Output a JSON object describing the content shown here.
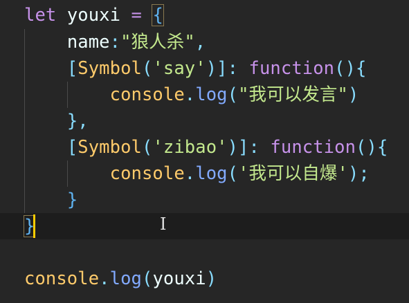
{
  "editor": {
    "lines": [
      [
        {
          "t": "let",
          "c": "kw"
        },
        {
          "t": " "
        },
        {
          "t": "youxi",
          "c": "id"
        },
        {
          "t": " "
        },
        {
          "t": "=",
          "c": "op"
        },
        {
          "t": " "
        },
        {
          "t": "{",
          "c": "br match"
        }
      ],
      [
        {
          "t": "    "
        },
        {
          "t": "name",
          "c": "prop"
        },
        {
          "t": ":",
          "c": "pun"
        },
        {
          "t": "\"狼人杀\"",
          "c": "str"
        },
        {
          "t": ",",
          "c": "pun"
        }
      ],
      [
        {
          "t": "    "
        },
        {
          "t": "[",
          "c": "pun"
        },
        {
          "t": "Symbol",
          "c": "cls"
        },
        {
          "t": "(",
          "c": "pun"
        },
        {
          "t": "'say'",
          "c": "str"
        },
        {
          "t": ")]",
          "c": "pun"
        },
        {
          "t": ":",
          "c": "pun"
        },
        {
          "t": " "
        },
        {
          "t": "function",
          "c": "kw"
        },
        {
          "t": "(){",
          "c": "pun"
        }
      ],
      [
        {
          "t": "        "
        },
        {
          "t": "console",
          "c": "cls"
        },
        {
          "t": ".",
          "c": "pun"
        },
        {
          "t": "log",
          "c": "fn"
        },
        {
          "t": "(",
          "c": "pun"
        },
        {
          "t": "\"我可以发言\"",
          "c": "str"
        },
        {
          "t": ")",
          "c": "pun"
        }
      ],
      [
        {
          "t": "    "
        },
        {
          "t": "},",
          "c": "pun"
        }
      ],
      [
        {
          "t": "    "
        },
        {
          "t": "[",
          "c": "pun"
        },
        {
          "t": "Symbol",
          "c": "cls"
        },
        {
          "t": "(",
          "c": "pun"
        },
        {
          "t": "'zibao'",
          "c": "str"
        },
        {
          "t": ")]",
          "c": "pun"
        },
        {
          "t": ":",
          "c": "pun"
        },
        {
          "t": " "
        },
        {
          "t": "function",
          "c": "kw"
        },
        {
          "t": "(){",
          "c": "pun"
        }
      ],
      [
        {
          "t": "        "
        },
        {
          "t": "console",
          "c": "cls"
        },
        {
          "t": ".",
          "c": "pun"
        },
        {
          "t": "log",
          "c": "fn"
        },
        {
          "t": "(",
          "c": "pun"
        },
        {
          "t": "'我可以自爆'",
          "c": "str"
        },
        {
          "t": ");",
          "c": "pun"
        }
      ],
      [
        {
          "t": "    "
        },
        {
          "t": "}",
          "c": "br"
        }
      ],
      [
        {
          "t": "}",
          "c": "br match"
        }
      ],
      [],
      [
        {
          "t": "console",
          "c": "cls"
        },
        {
          "t": ".",
          "c": "pun"
        },
        {
          "t": "log",
          "c": "fn"
        },
        {
          "t": "(",
          "c": "pun"
        },
        {
          "t": "youxi",
          "c": "id"
        },
        {
          "t": ")",
          "c": "pun"
        }
      ]
    ]
  },
  "cursor_glyph": "I"
}
